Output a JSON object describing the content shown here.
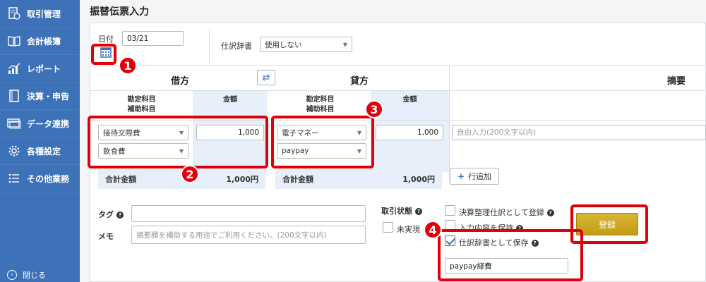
{
  "sidebar": {
    "items": [
      {
        "label": "取引管理",
        "icon": "document-icon"
      },
      {
        "label": "会計帳簿",
        "icon": "book-icon"
      },
      {
        "label": "レポート",
        "icon": "chart-icon"
      },
      {
        "label": "決算・申告",
        "icon": "tablet-icon"
      },
      {
        "label": "データ連携",
        "icon": "card-icon"
      },
      {
        "label": "各種設定",
        "icon": "gear-icon"
      },
      {
        "label": "その他業務",
        "icon": "list-icon"
      }
    ],
    "close_label": "閉じる"
  },
  "page": {
    "title": "振替伝票入力"
  },
  "form": {
    "date_label": "日付",
    "date_value": "03/21",
    "dict_label": "仕訳辞書",
    "dict_value": "使用しない"
  },
  "table": {
    "debit_header": "借方",
    "credit_header": "貸方",
    "memo_header": "摘要",
    "account_header_1": "勘定科目",
    "account_header_2": "補助科目",
    "amount_header": "金額",
    "debit": {
      "account": "接待交際費",
      "sub_account": "飲食費",
      "amount": "1,000"
    },
    "credit": {
      "account": "電子マネー",
      "sub_account": "paypay",
      "amount": "1,000"
    },
    "memo_placeholder": "自由入力(200文字以内)",
    "total_label": "合計金額",
    "debit_total": "1,000円",
    "credit_total": "1,000円",
    "add_row_label": "行追加"
  },
  "meta": {
    "tag_label": "タグ",
    "memo_label": "メモ",
    "memo_placeholder": "摘要欄を補助する用途でご利用ください。(200文字以内)",
    "status_label": "取引状態",
    "unrealized_label": "未実現",
    "settlement_label": "決算整理仕訳として登録",
    "keep_input_label": "入力内容を保持",
    "save_dict_label": "仕訳辞書として保存",
    "dict_name_value": "paypay経費",
    "register_label": "登録"
  },
  "annotations": {
    "badges": [
      "1",
      "2",
      "3",
      "4"
    ],
    "color": "#e0000a"
  },
  "colors": {
    "sidebar": "#3d72b8",
    "accent_blue": "#e7effa",
    "register": "#c9a31a"
  }
}
